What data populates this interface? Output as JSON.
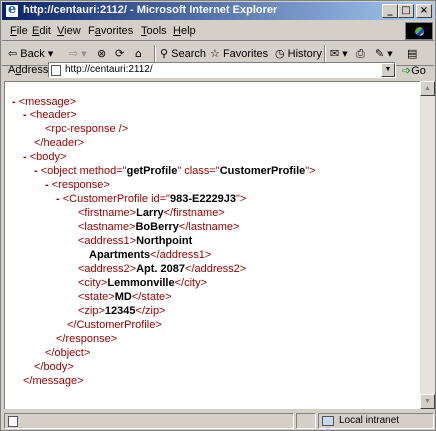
{
  "window": {
    "title": "http://centauri:2112/ - Microsoft Internet Explorer",
    "buttons": {
      "minimize": "_",
      "maximize": "□",
      "close": "×"
    }
  },
  "menu": [
    {
      "label": "File",
      "u": "F",
      "rest": "ile"
    },
    {
      "label": "Edit",
      "u": "E",
      "rest": "dit"
    },
    {
      "label": "View",
      "u": "V",
      "rest": "iew"
    },
    {
      "label": "Favorites",
      "u": "a",
      "pre": "F",
      "rest": "vorites"
    },
    {
      "label": "Tools",
      "u": "T",
      "rest": "ools"
    },
    {
      "label": "Help",
      "u": "H",
      "rest": "elp"
    }
  ],
  "toolbar": {
    "back": "Back",
    "search": "Search",
    "favorites": "Favorites",
    "history": "History",
    "icons": [
      "back-arrow-icon",
      "forward-arrow-icon",
      "stop-icon",
      "refresh-icon",
      "home-icon",
      "search-icon",
      "favorites-icon",
      "history-icon",
      "mail-icon",
      "print-icon",
      "edit-icon",
      "discuss-icon"
    ]
  },
  "address": {
    "label_u": "d",
    "label_pre": "A",
    "label_rest": "dress",
    "url": "http://centauri:2112/",
    "go": "Go"
  },
  "xml": {
    "lines": [
      {
        "mk": "-",
        "open": "<message>"
      },
      {
        "mk": "-",
        "open": "<header>"
      },
      {
        "mk": "",
        "open": "<rpc-response />"
      },
      {
        "mk": "",
        "open": "</header>"
      },
      {
        "mk": "-",
        "open": "<body>"
      },
      {
        "mk": "-",
        "object_prefix": "<object method=\"",
        "method": "getProfile",
        "object_mid": "\" class=\"",
        "class": "CustomerProfile",
        "object_suffix": "\">"
      },
      {
        "mk": "-",
        "open": "<response>"
      },
      {
        "mk": "-",
        "cp_prefix": "<CustomerProfile id=\"",
        "id": "983-E2229J3",
        "cp_suffix": "\">"
      },
      {
        "tag_open": "<firstname>",
        "text": "Larry",
        "tag_close": "</firstname>"
      },
      {
        "tag_open": "<lastname>",
        "text": "BoBerry",
        "tag_close": "</lastname>"
      },
      {
        "tag_open": "<address1>",
        "text": "Northpoint"
      },
      {
        "text": "Apartments",
        "tag_close": "</address1>"
      },
      {
        "tag_open": "<address2>",
        "text": "Apt. 2087",
        "tag_close": "</address2>"
      },
      {
        "tag_open": "<city>",
        "text": "Lemmonville",
        "tag_close": "</city>"
      },
      {
        "tag_open": "<state>",
        "text": "MD",
        "tag_close": "</state>"
      },
      {
        "tag_open": "<zip>",
        "text": "12345",
        "tag_close": "</zip>"
      },
      {
        "open": "</CustomerProfile>"
      },
      {
        "open": "</response>"
      },
      {
        "open": "</object>"
      },
      {
        "open": "</body>"
      },
      {
        "open": "</message>"
      }
    ]
  },
  "status": {
    "zone": "Local intranet"
  }
}
